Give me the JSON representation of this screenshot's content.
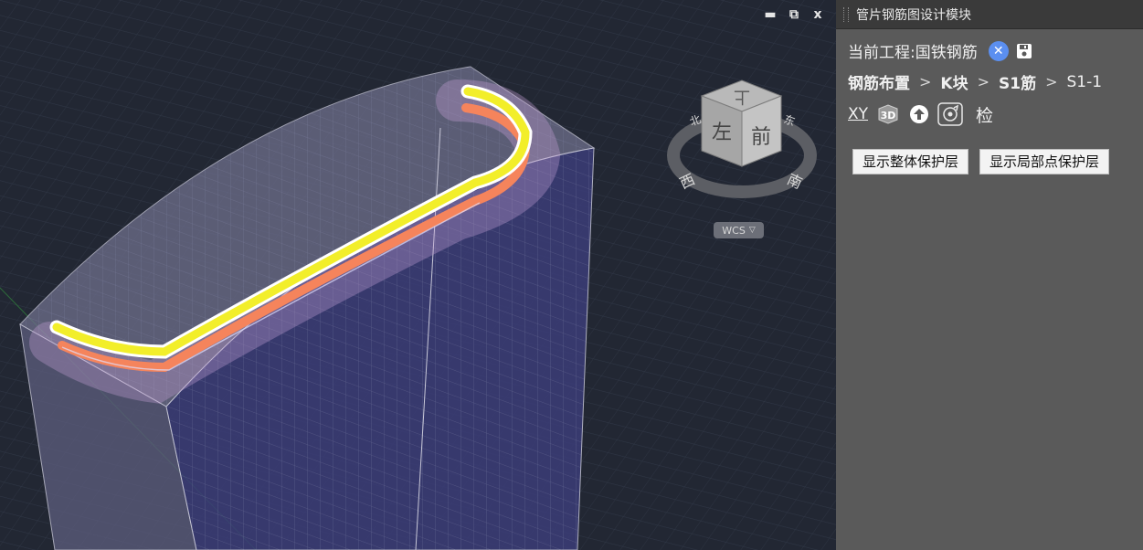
{
  "viewport": {
    "window_controls": {
      "minimize": "▬",
      "restore": "⧉",
      "close": "x"
    },
    "viewcube": {
      "top": "上",
      "front": "前",
      "left": "左",
      "west": "西",
      "south": "南",
      "east": "东",
      "north": "北"
    },
    "wcs_label": "WCS"
  },
  "panel": {
    "title": "管片钢筋图设计模块",
    "project_label": "当前工程:国铁钢筋",
    "breadcrumb": [
      "钢筋布置",
      "K块",
      "S1筋",
      "S1-1"
    ],
    "tools": {
      "xy": "XY",
      "threed": "3D",
      "check": "检"
    },
    "buttons": {
      "show_overall": "显示整体保护层",
      "show_local": "显示局部点保护层"
    }
  }
}
